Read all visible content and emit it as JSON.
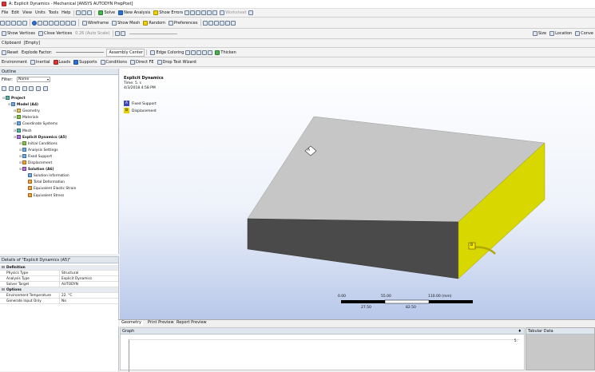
{
  "window": {
    "title": "A: Explicit Dynamics - Mechanical [ANSYS AUTODYN PrepPost]"
  },
  "menu": [
    "File",
    "Edit",
    "View",
    "Units",
    "Tools",
    "Help"
  ],
  "toolbar1": {
    "solve": "Solve",
    "new_analysis": "New Analysis",
    "show_errors": "Show Errors",
    "worksheet": "Worksheet"
  },
  "toolbar2": {
    "wireframe": "Wireframe",
    "show_mesh": "Show Mesh",
    "random": "Random",
    "preferences": "Preferences"
  },
  "toolbar3": {
    "show_vertices": "Show Vertices",
    "close_vertices": "Close Vertices",
    "auto_scale": "0.26 (Auto Scale)",
    "size": "Size",
    "location": "Location",
    "convert": "Conve"
  },
  "toolbar4": {
    "clipboard": "Clipboard",
    "clipboard_value": "[Empty]"
  },
  "toolbar5": {
    "reset": "Reset",
    "explode_factor": "Explode Factor:",
    "assembly_center": "Assembly Center",
    "edge_coloring": "Edge Coloring",
    "thicken": "Thicken"
  },
  "environment": {
    "label": "Environment",
    "inertial": "Inertial",
    "loads": "Loads",
    "supports": "Supports",
    "conditions": "Conditions",
    "direct_fe": "Direct FE",
    "drop_test": "Drop Test Wizard"
  },
  "outline": {
    "title": "Outline",
    "filter_label": "Filter:",
    "filter_value": "Name",
    "tree": [
      {
        "label": "Project",
        "level": 0,
        "icon": "project",
        "bold": true
      },
      {
        "label": "Model (A4)",
        "level": 1,
        "icon": "model",
        "bold": true
      },
      {
        "label": "Geometry",
        "level": 2,
        "icon": "geometry"
      },
      {
        "label": "Materials",
        "level": 2,
        "icon": "materials"
      },
      {
        "label": "Coordinate Systems",
        "level": 2,
        "icon": "coord"
      },
      {
        "label": "Mesh",
        "level": 2,
        "icon": "mesh"
      },
      {
        "label": "Explicit Dynamics (A5)",
        "level": 2,
        "icon": "analysis",
        "bold": true
      },
      {
        "label": "Initial Conditions",
        "level": 3,
        "icon": "init"
      },
      {
        "label": "Analysis Settings",
        "level": 3,
        "icon": "settings"
      },
      {
        "label": "Fixed Support",
        "level": 3,
        "icon": "fixed"
      },
      {
        "label": "Displacement",
        "level": 3,
        "icon": "disp"
      },
      {
        "label": "Solution (A6)",
        "level": 3,
        "icon": "solution",
        "bold": true
      },
      {
        "label": "Solution Information",
        "level": 4,
        "icon": "info"
      },
      {
        "label": "Total Deformation",
        "level": 4,
        "icon": "result"
      },
      {
        "label": "Equivalent Elastic Strain",
        "level": 4,
        "icon": "result"
      },
      {
        "label": "Equivalent Stress",
        "level": 4,
        "icon": "result"
      }
    ]
  },
  "details": {
    "title": "Details of \"Explicit Dynamics (A5)\"",
    "sections": [
      {
        "name": "Definition",
        "rows": [
          {
            "key": "Physics Type",
            "value": "Structural"
          },
          {
            "key": "Analysis Type",
            "value": "Explicit Dynamics"
          },
          {
            "key": "Solver Target",
            "value": "AUTODYN"
          }
        ]
      },
      {
        "name": "Options",
        "rows": [
          {
            "key": "Environment Temperature",
            "value": "22. °C"
          },
          {
            "key": "Generate Input Only",
            "value": "No"
          }
        ]
      }
    ]
  },
  "viewport": {
    "title": "Explicit Dynamics",
    "subtitle": "Time: 5. s",
    "date": "4/3/2018 4:58 PM",
    "legend": [
      {
        "tag": "A",
        "label": "Fixed Support",
        "color": "#3b49b8"
      },
      {
        "tag": "B",
        "label": "Displacement",
        "color": "#e6d000"
      }
    ],
    "scale": {
      "t0": "0.00",
      "t1": "55.00",
      "t2": "110.00 (mm)",
      "t3": "27.50",
      "t4": "82.50"
    },
    "marker_a": "A",
    "marker_b": "B"
  },
  "tabs": {
    "geometry": "Geometry",
    "print_preview": "Print Preview",
    "report_preview": "Report Preview"
  },
  "graph": {
    "title": "Graph",
    "pin": "♦",
    "value": "5."
  },
  "tabular": {
    "title": "Tabular Data"
  }
}
